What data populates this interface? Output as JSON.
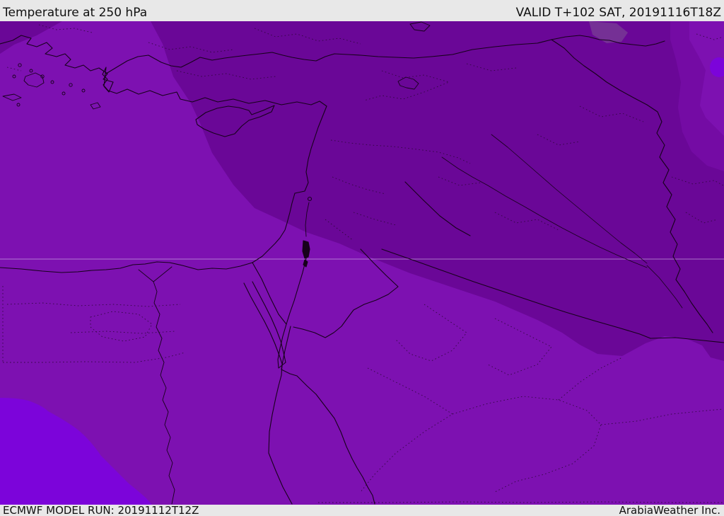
{
  "header": {
    "title": "Temperature at 250 hPa",
    "valid_time": "VALID T+102 SAT, 20191116T18Z"
  },
  "footer": {
    "model_run": "ECMWF MODEL RUN: 20191112T12Z",
    "brand": "ArabiaWeather Inc."
  },
  "map": {
    "description": "ECMWF 250 hPa temperature shading over the Middle East",
    "palette": {
      "bar_bg": "#e8e8e8",
      "bar_text": "#111111",
      "band_base": "#7d11b1",
      "band_dark": "#6a0797",
      "band_mid_dark": "#740ba4",
      "band_violet": "#7c04da",
      "terrain_overlay": "#8a7f92",
      "coastline": "#17011b",
      "admin_border": "#2c0838",
      "graticule": "rgba(235,225,248,0.5)"
    }
  }
}
